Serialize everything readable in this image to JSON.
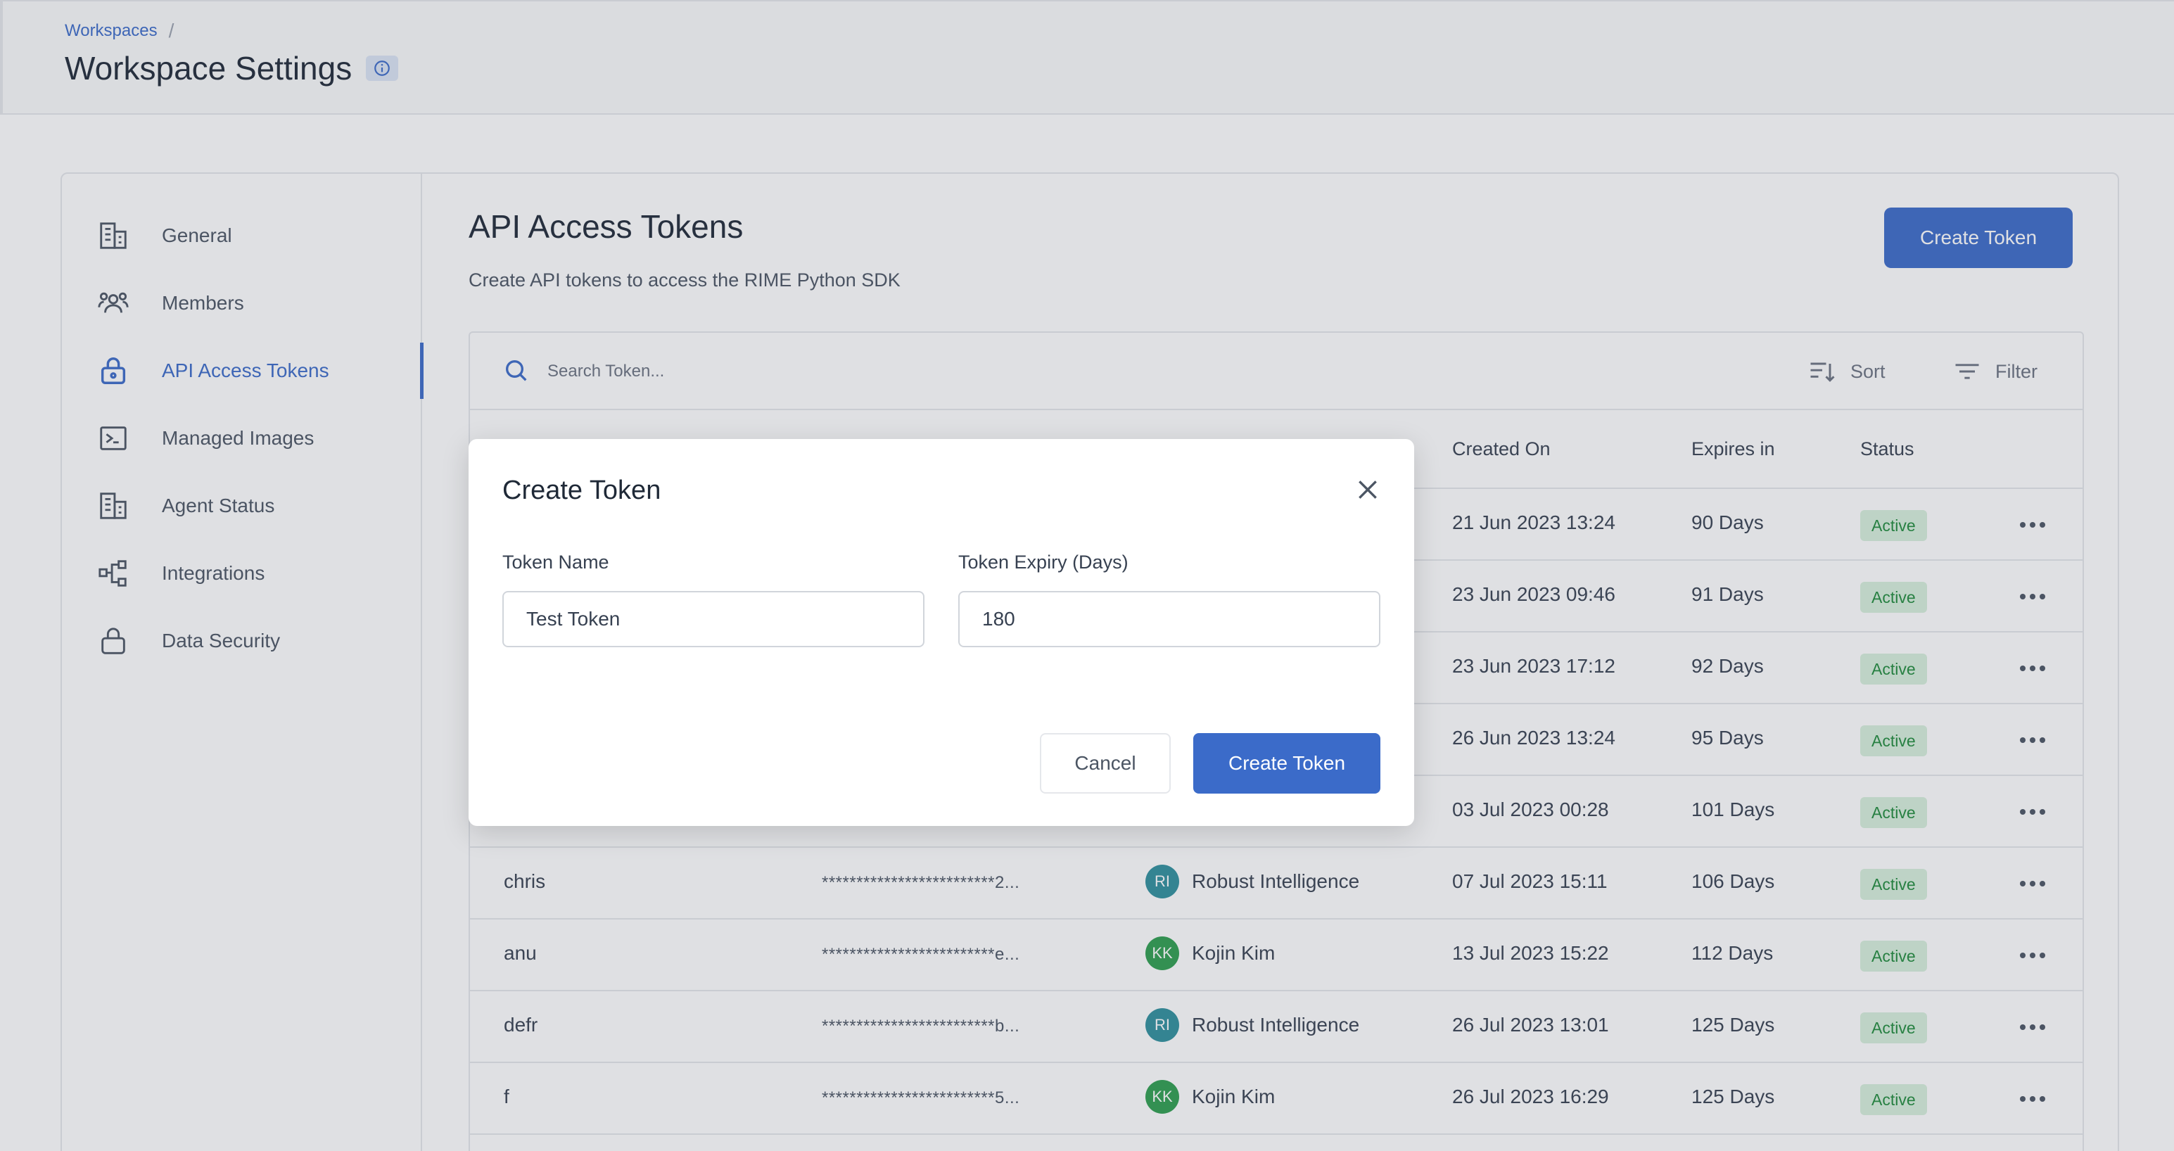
{
  "header": {
    "breadcrumb": "Workspaces",
    "breadcrumb_sep": "/",
    "title": "Workspace Settings"
  },
  "sidebar": {
    "items": [
      {
        "label": "General",
        "icon": "building-icon"
      },
      {
        "label": "Members",
        "icon": "members-icon"
      },
      {
        "label": "API Access Tokens",
        "icon": "lock-icon",
        "active": true
      },
      {
        "label": "Managed Images",
        "icon": "terminal-icon"
      },
      {
        "label": "Agent Status",
        "icon": "building-icon"
      },
      {
        "label": "Integrations",
        "icon": "integrations-icon"
      },
      {
        "label": "Data Security",
        "icon": "lock-icon"
      }
    ]
  },
  "content": {
    "title": "API Access Tokens",
    "subtitle": "Create API tokens to access the RIME Python SDK",
    "create_button": "Create Token"
  },
  "toolbar": {
    "search_placeholder": "Search Token...",
    "sort_label": "Sort",
    "filter_label": "Filter"
  },
  "table": {
    "columns": [
      "Created On",
      "Expires in",
      "Status"
    ],
    "rows": [
      {
        "name": "",
        "token": "",
        "owner": "",
        "initials": "",
        "created": "21 Jun 2023 13:24",
        "expires": "90 Days",
        "status": "Active"
      },
      {
        "name": "",
        "token": "",
        "owner": "",
        "initials": "",
        "created": "23 Jun 2023 09:46",
        "expires": "91 Days",
        "status": "Active"
      },
      {
        "name": "",
        "token": "",
        "owner": "",
        "initials": "",
        "created": "23 Jun 2023 17:12",
        "expires": "92 Days",
        "status": "Active"
      },
      {
        "name": "",
        "token": "",
        "owner": "",
        "initials": "",
        "created": "26 Jun 2023 13:24",
        "expires": "95 Days",
        "status": "Active"
      },
      {
        "name": "",
        "token": "",
        "owner": "",
        "initials": "",
        "created": "03 Jul 2023 00:28",
        "expires": "101 Days",
        "status": "Active"
      },
      {
        "name": "chris",
        "token": "*************************2...",
        "owner": "Robust Intelligence",
        "initials": "RI",
        "created": "07 Jul 2023 15:11",
        "expires": "106 Days",
        "status": "Active"
      },
      {
        "name": "anu",
        "token": "*************************e...",
        "owner": "Kojin Kim",
        "initials": "KK",
        "created": "13 Jul 2023 15:22",
        "expires": "112 Days",
        "status": "Active"
      },
      {
        "name": "defr",
        "token": "*************************b...",
        "owner": "Robust Intelligence",
        "initials": "RI",
        "created": "26 Jul 2023 13:01",
        "expires": "125 Days",
        "status": "Active"
      },
      {
        "name": "f",
        "token": "*************************5...",
        "owner": "Kojin Kim",
        "initials": "KK",
        "created": "26 Jul 2023 16:29",
        "expires": "125 Days",
        "status": "Active"
      }
    ]
  },
  "modal": {
    "title": "Create Token",
    "token_name_label": "Token Name",
    "token_name_value": "Test Token",
    "expiry_label": "Token Expiry (Days)",
    "expiry_value": "180",
    "cancel_label": "Cancel",
    "create_label": "Create Token"
  },
  "colors": {
    "accent": "#3b6bc9",
    "avatar_ri": "#2f8f9d",
    "avatar_kk": "#2e9e4f",
    "status_bg": "#d7f0dc",
    "status_text": "#1f8a3b"
  }
}
